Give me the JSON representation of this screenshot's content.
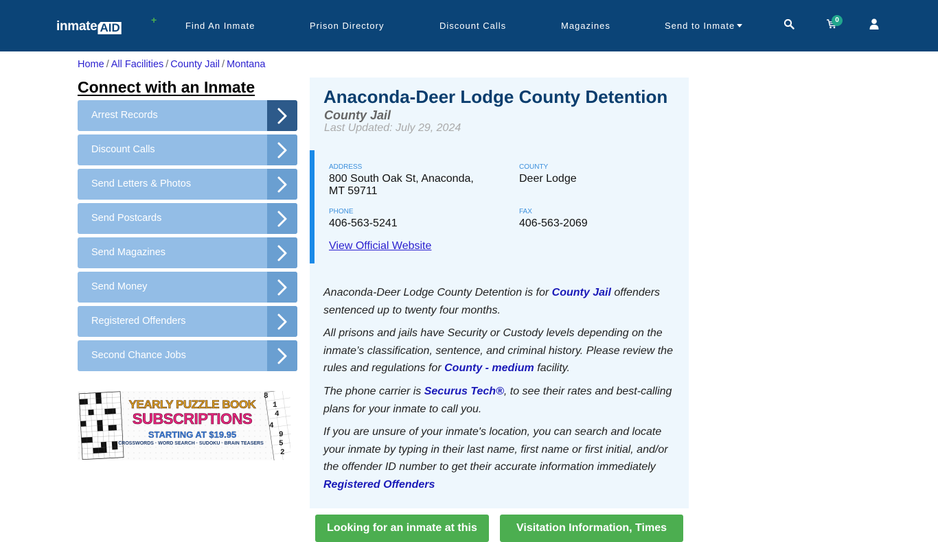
{
  "brand": {
    "logo_part1": "inmate",
    "logo_part2": "AID",
    "logo_plus": "+"
  },
  "nav": {
    "items": [
      {
        "label": "Find An Inmate"
      },
      {
        "label": "Prison Directory"
      },
      {
        "label": "Discount Calls"
      },
      {
        "label": "Magazines"
      },
      {
        "label": "Send to Inmate",
        "has_dropdown": true
      }
    ],
    "icons": [
      "search-icon",
      "cart-icon",
      "user-icon"
    ],
    "cart_count": "0"
  },
  "breadcrumb": [
    {
      "label": "Home"
    },
    {
      "label": "All Facilities"
    },
    {
      "label": "County Jail"
    },
    {
      "label": "Montana"
    }
  ],
  "breadcrumb_sep": "/",
  "sidebar": {
    "title": "Connect with an Inmate",
    "items": [
      {
        "label": "Arrest Records",
        "active": true
      },
      {
        "label": "Discount Calls"
      },
      {
        "label": "Send Letters & Photos"
      },
      {
        "label": "Send Postcards"
      },
      {
        "label": "Send Magazines"
      },
      {
        "label": "Send Money"
      },
      {
        "label": "Registered Offenders"
      },
      {
        "label": "Second Chance Jobs"
      }
    ],
    "ad": {
      "line1": "YEARLY PUZZLE BOOK",
      "line2": "SUBSCRIPTIONS",
      "line3": "STARTING AT $19.95",
      "line4": "CROSSWORDS · WORD SEARCH · SUDOKU · BRAIN TEASERS",
      "sudoku_digits": [
        "8",
        "1",
        "4",
        "4",
        "9",
        "5",
        "2"
      ]
    }
  },
  "facility": {
    "name": "Anaconda-Deer Lodge County Detention",
    "type": "County Jail",
    "last_updated": "Last Updated: July 29, 2024",
    "address_label": "ADDRESS",
    "address_line1": "800 South Oak St, Anaconda,",
    "address_line2": "MT 59711",
    "county_label": "COUNTY",
    "county": "Deer Lodge",
    "phone_label": "PHONE",
    "phone": "406-563-5241",
    "fax_label": "FAX",
    "fax": "406-563-2069",
    "website_link": "View Official Website"
  },
  "description": {
    "p1_a": "Anaconda-Deer Lodge County Detention is for ",
    "p1_link": "County Jail",
    "p1_b": " offenders sentenced up to twenty four months.",
    "p2_a": "All prisons and jails have Security or Custody levels depending on the inmate’s classification, sentence, and criminal history. Please review the rules and regulations for ",
    "p2_link": "County - medium",
    "p2_b": " facility.",
    "p3_a": "The phone carrier is ",
    "p3_link": "Securus Tech®",
    "p3_b": ", to see their rates and best-calling plans for your inmate to call you.",
    "p4_a": "If you are unsure of your inmate's location, you can search and locate your inmate by typing in their last name, first name or first initial, and/or the offender ID number to get their accurate information immediately ",
    "p4_link": "Registered Offenders"
  },
  "buttons": {
    "looking": "Looking for an inmate at this",
    "visitation": "Visitation Information, Times"
  },
  "colors": {
    "navbar": "#0b4477",
    "sidebar_item": "#93bde6",
    "sidebar_arrow": "#6a9fd1",
    "sidebar_arrow_active": "#2d5a8a",
    "content_bg": "#eef7fd",
    "accent_bar": "#1a8ae8",
    "green_button": "#4cae50",
    "link": "#1a1ab8"
  }
}
